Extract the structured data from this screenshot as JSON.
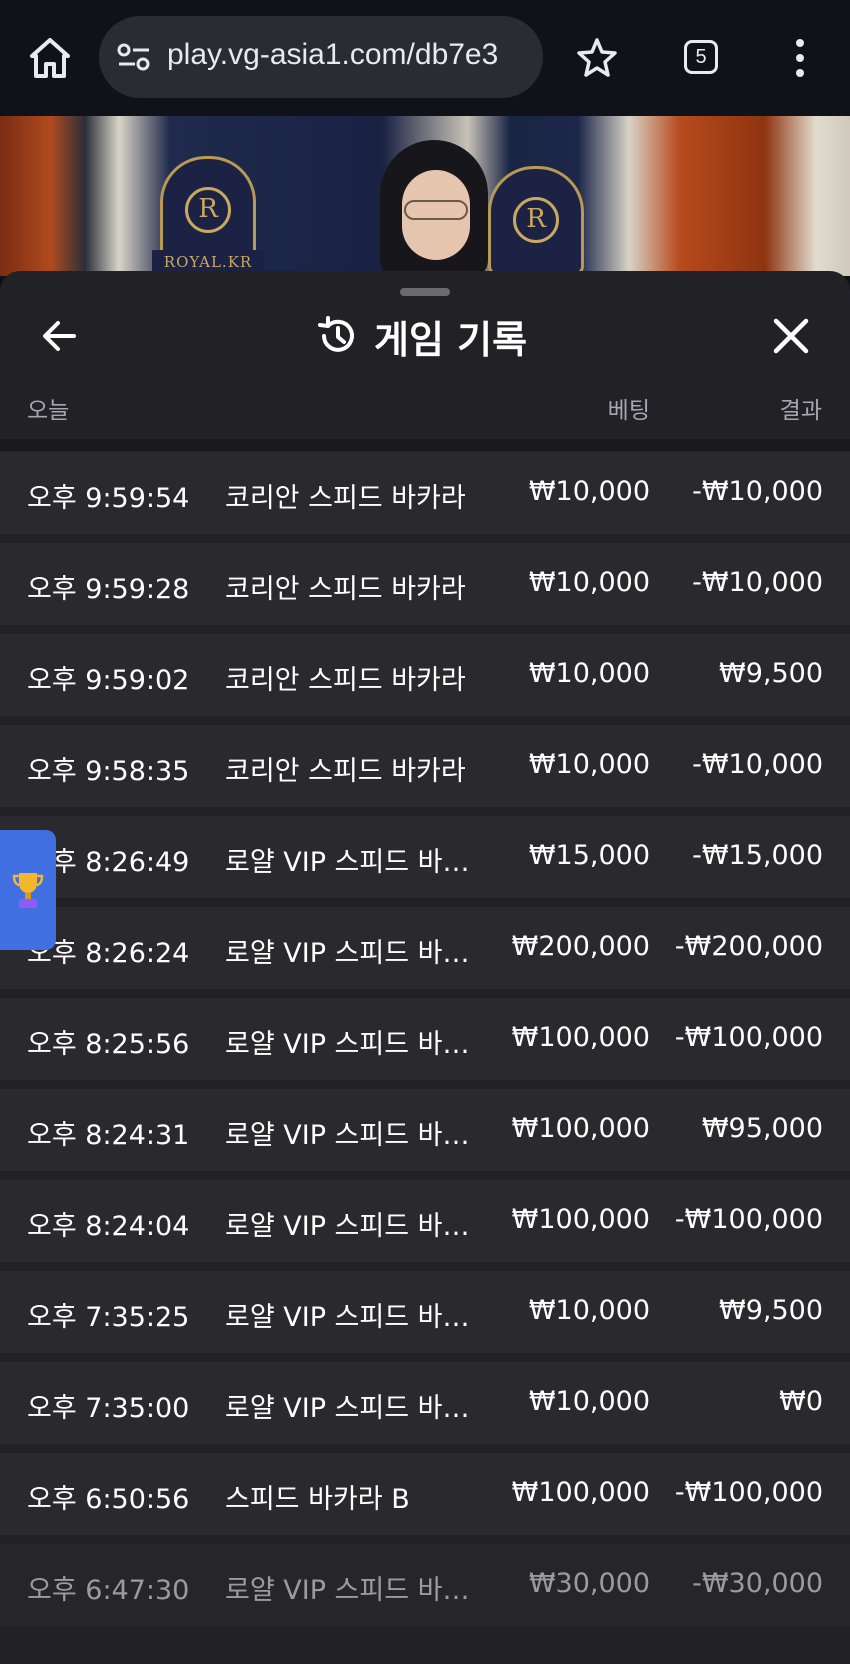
{
  "browser": {
    "url": "play.vg-asia1.com/db7e3",
    "tab_count": "5",
    "icons": [
      "home-icon",
      "site-settings-icon",
      "star-icon",
      "tabs-icon",
      "more-vert-icon"
    ]
  },
  "video": {
    "brand_label": "ROYAL.KR",
    "crest_letter": "R"
  },
  "sheet": {
    "title": "게임 기록",
    "header": {
      "today": "오늘",
      "bet": "베팅",
      "result": "결과"
    },
    "rows": [
      {
        "time": "오후 9:59:54",
        "game": "코리안 스피드 바카라",
        "bet": "₩10,000",
        "result": "-₩10,000"
      },
      {
        "time": "오후 9:59:28",
        "game": "코리안 스피드 바카라",
        "bet": "₩10,000",
        "result": "-₩10,000"
      },
      {
        "time": "오후 9:59:02",
        "game": "코리안 스피드 바카라",
        "bet": "₩10,000",
        "result": "₩9,500"
      },
      {
        "time": "오후 9:58:35",
        "game": "코리안 스피드 바카라",
        "bet": "₩10,000",
        "result": "-₩10,000"
      },
      {
        "time": "오후 8:26:49",
        "game": "로얄 VIP 스피드 바카라",
        "bet": "₩15,000",
        "result": "-₩15,000"
      },
      {
        "time": "오후 8:26:24",
        "game": "로얄 VIP 스피드 바카라",
        "bet": "₩200,000",
        "result": "-₩200,000"
      },
      {
        "time": "오후 8:25:56",
        "game": "로얄 VIP 스피드 바카라",
        "bet": "₩100,000",
        "result": "-₩100,000"
      },
      {
        "time": "오후 8:24:31",
        "game": "로얄 VIP 스피드 바카라",
        "bet": "₩100,000",
        "result": "₩95,000"
      },
      {
        "time": "오후 8:24:04",
        "game": "로얄 VIP 스피드 바카라",
        "bet": "₩100,000",
        "result": "-₩100,000"
      },
      {
        "time": "오후 7:35:25",
        "game": "로얄 VIP 스피드 바카라",
        "bet": "₩10,000",
        "result": "₩9,500"
      },
      {
        "time": "오후 7:35:00",
        "game": "로얄 VIP 스피드 바카라",
        "bet": "₩10,000",
        "result": "₩0"
      },
      {
        "time": "오후 6:50:56",
        "game": "스피드 바카라 B",
        "bet": "₩100,000",
        "result": "-₩100,000"
      },
      {
        "time": "오후 6:47:30",
        "game": "로얄 VIP 스피드 바카라",
        "bet": "₩30,000",
        "result": "-₩30,000"
      }
    ]
  },
  "colors": {
    "sheet_bg": "#212126",
    "row_bg": "#29292e",
    "trophy_tab": "#3f6fe0"
  }
}
